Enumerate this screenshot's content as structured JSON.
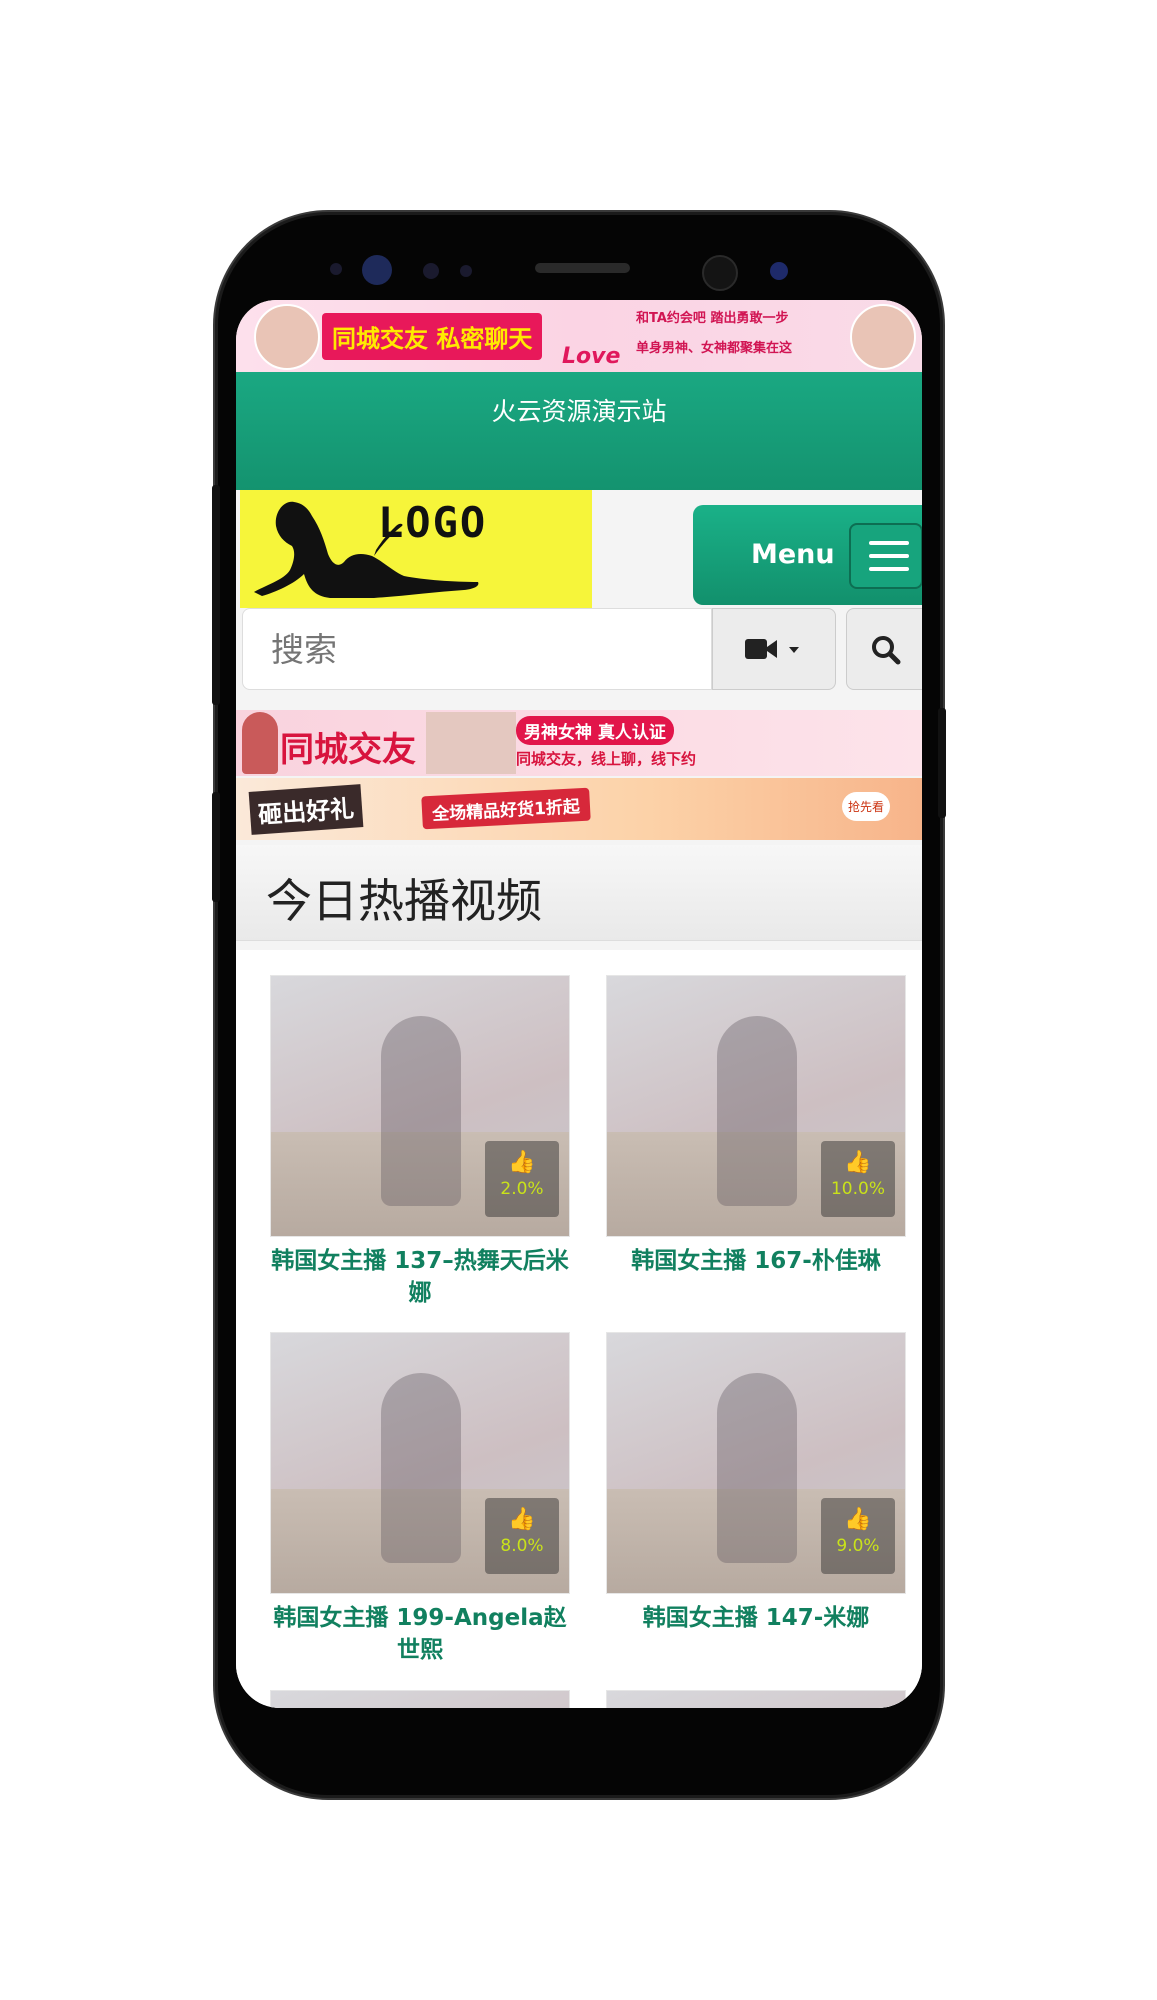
{
  "ads": {
    "top_left": "同城交友 私密聊天",
    "top_right_line1": "和TA约会吧 踏出勇敢一步",
    "top_right_line2": "单身男神、女神都聚集在这",
    "top_love": "Love",
    "banner2_left": "同城交友",
    "banner2_right_line1": "男神女神 真人认证",
    "banner2_right_line2": "同城交友，线上聊，线下约",
    "banner3_left": "砸出好礼",
    "banner3_mid": "全场精品好货1折起",
    "banner3_badge": "抢先看"
  },
  "header": {
    "site_title": "火云资源演示站"
  },
  "logo": {
    "text": "LOGO"
  },
  "menu": {
    "label": "Menu"
  },
  "search": {
    "placeholder": "搜索"
  },
  "section": {
    "title": "今日热播视频"
  },
  "videos": [
    {
      "title": "韩国女主播 137–热舞天后米娜",
      "likes": "2.0%"
    },
    {
      "title": "韩国女主播 167-朴佳琳",
      "likes": "10.0%"
    },
    {
      "title": "韩国女主播 199-Angela赵世熙",
      "likes": "8.0%"
    },
    {
      "title": "韩国女主播 147-米娜",
      "likes": "9.0%"
    }
  ],
  "colors": {
    "accent": "#14936f",
    "logo_bg": "#f6f53a",
    "caption": "#11805f"
  }
}
